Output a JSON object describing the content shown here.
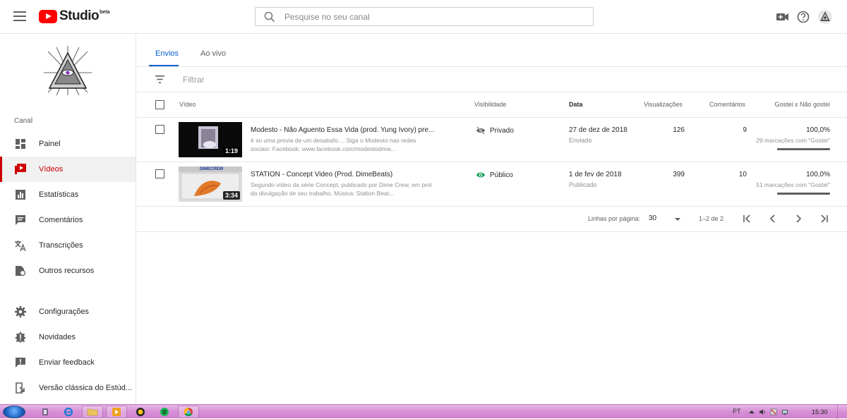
{
  "header": {
    "logo_text": "Studio",
    "logo_badge": "beta",
    "search_placeholder": "Pesquise no seu canal"
  },
  "sidebar": {
    "section_label": "Canal",
    "items": [
      {
        "label": "Painel",
        "icon": "dashboard-icon"
      },
      {
        "label": "Vídeos",
        "icon": "video-icon",
        "active": true
      },
      {
        "label": "Estatísticas",
        "icon": "analytics-icon"
      },
      {
        "label": "Comentários",
        "icon": "comments-icon"
      },
      {
        "label": "Transcrições",
        "icon": "translate-icon"
      },
      {
        "label": "Outros recursos",
        "icon": "other-features-icon"
      },
      {
        "label": "Configurações",
        "icon": "gear-icon"
      },
      {
        "label": "Novidades",
        "icon": "whats-new-icon"
      },
      {
        "label": "Enviar feedback",
        "icon": "feedback-icon"
      },
      {
        "label": "Versão clássica do Estúd...",
        "icon": "classic-studio-icon"
      }
    ]
  },
  "tabs": [
    {
      "label": "Envios",
      "active": true
    },
    {
      "label": "Ao vivo",
      "active": false
    }
  ],
  "filter": {
    "placeholder": "Filtrar"
  },
  "table": {
    "columns": {
      "video": "Vídeo",
      "visibility": "Visibilidade",
      "date": "Data",
      "views": "Visualizações",
      "comments": "Comentários",
      "likes": "Gostei x Não gostei"
    },
    "rows": [
      {
        "title": "Modesto - Não Aguento Essa Vida (prod. Yung Ivory) pre...",
        "description": "é so uma previa de um desabafo.... Siga o Modesto nas redes sociais: Facebook: www.facebook.com/modestodmw...",
        "duration": "1:19",
        "visibility": "Privado",
        "date": "27 de dez de 2018",
        "date_status": "Enviado",
        "views": "126",
        "comments": "9",
        "likes_pct": "100,0%",
        "likes_sub": "29 marcações com \"Gostei\""
      },
      {
        "title": "STATION - Concept Video (Prod. DimeBeats)",
        "description": "Segundo vídeo da série Concept, publicado por Dime Crew, em prol da divulgação de seu trabalho. Música: Station Beat...",
        "duration": "3:34",
        "thumb_text": "DIMECREW",
        "visibility": "Público",
        "date": "1 de fev de 2018",
        "date_status": "Publicado",
        "views": "399",
        "comments": "10",
        "likes_pct": "100,0%",
        "likes_sub": "51 marcações com \"Gostei\""
      }
    ]
  },
  "pager": {
    "rows_label": "Linhas por página:",
    "rows_value": "30",
    "range": "1–2 de 2"
  },
  "taskbar": {
    "lang": "PT",
    "clock": "15:30"
  },
  "colors": {
    "accent_blue": "#065fd4",
    "active_red": "#cc0000",
    "public_green": "#0f9d58",
    "taskbar_pink": "#d88fd8"
  }
}
